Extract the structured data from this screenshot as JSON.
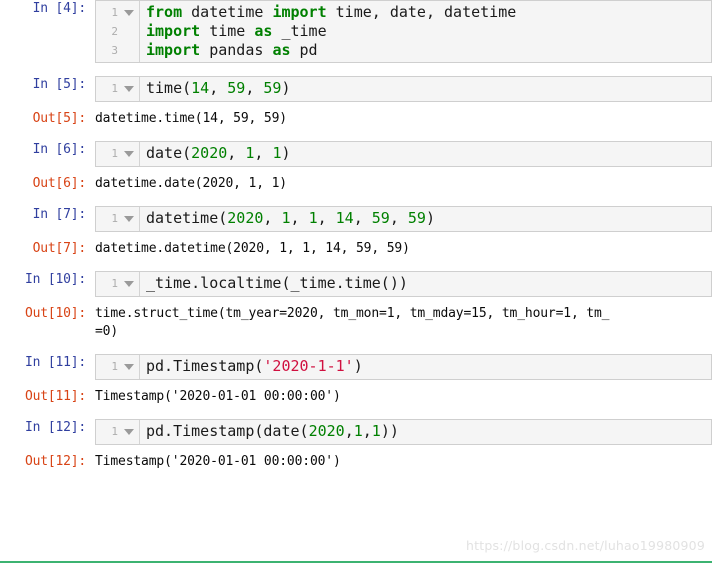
{
  "notebook": {
    "watermark": "https://blog.csdn.net/luhao19980909",
    "accent_color": "#3cb371",
    "in_prompt_color": "#303f9f",
    "out_prompt_color": "#d84315",
    "keyword_color": "#008000",
    "number_color": "#008000",
    "string_color": "#d01040",
    "cell_background": "#f5f5f5",
    "collapse_icon": "chevron-down-icon",
    "cells": [
      {
        "in_prompt": "In [4]:",
        "out_prompt": "",
        "line_numbers": [
          "1",
          "2",
          "3"
        ],
        "source_lines": [
          [
            {
              "t": "from ",
              "c": "kw"
            },
            {
              "t": "datetime ",
              "c": "pl"
            },
            {
              "t": "import ",
              "c": "kw"
            },
            {
              "t": "time, date, datetime",
              "c": "pl"
            }
          ],
          [
            {
              "t": "import ",
              "c": "kw"
            },
            {
              "t": "time ",
              "c": "pl"
            },
            {
              "t": "as ",
              "c": "kw"
            },
            {
              "t": "_time",
              "c": "pl"
            }
          ],
          [
            {
              "t": "import ",
              "c": "kw"
            },
            {
              "t": "pandas ",
              "c": "pl"
            },
            {
              "t": "as ",
              "c": "kw"
            },
            {
              "t": "pd",
              "c": "pl"
            }
          ]
        ],
        "output_lines": []
      },
      {
        "in_prompt": "In [5]:",
        "out_prompt": "Out[5]:",
        "line_numbers": [
          "1"
        ],
        "source_lines": [
          [
            {
              "t": "time(",
              "c": "pl"
            },
            {
              "t": "14",
              "c": "num"
            },
            {
              "t": ", ",
              "c": "pl"
            },
            {
              "t": "59",
              "c": "num"
            },
            {
              "t": ", ",
              "c": "pl"
            },
            {
              "t": "59",
              "c": "num"
            },
            {
              "t": ")",
              "c": "pl"
            }
          ]
        ],
        "output_lines": [
          "datetime.time(14, 59, 59)"
        ]
      },
      {
        "in_prompt": "In [6]:",
        "out_prompt": "Out[6]:",
        "line_numbers": [
          "1"
        ],
        "source_lines": [
          [
            {
              "t": "date(",
              "c": "pl"
            },
            {
              "t": "2020",
              "c": "num"
            },
            {
              "t": ", ",
              "c": "pl"
            },
            {
              "t": "1",
              "c": "num"
            },
            {
              "t": ", ",
              "c": "pl"
            },
            {
              "t": "1",
              "c": "num"
            },
            {
              "t": ")",
              "c": "pl"
            }
          ]
        ],
        "output_lines": [
          "datetime.date(2020, 1, 1)"
        ]
      },
      {
        "in_prompt": "In [7]:",
        "out_prompt": "Out[7]:",
        "line_numbers": [
          "1"
        ],
        "source_lines": [
          [
            {
              "t": "datetime(",
              "c": "pl"
            },
            {
              "t": "2020",
              "c": "num"
            },
            {
              "t": ", ",
              "c": "pl"
            },
            {
              "t": "1",
              "c": "num"
            },
            {
              "t": ", ",
              "c": "pl"
            },
            {
              "t": "1",
              "c": "num"
            },
            {
              "t": ", ",
              "c": "pl"
            },
            {
              "t": "14",
              "c": "num"
            },
            {
              "t": ", ",
              "c": "pl"
            },
            {
              "t": "59",
              "c": "num"
            },
            {
              "t": ", ",
              "c": "pl"
            },
            {
              "t": "59",
              "c": "num"
            },
            {
              "t": ")",
              "c": "pl"
            }
          ]
        ],
        "output_lines": [
          "datetime.datetime(2020, 1, 1, 14, 59, 59)"
        ]
      },
      {
        "in_prompt": "In [10]:",
        "out_prompt": "Out[10]:",
        "line_numbers": [
          "1"
        ],
        "source_lines": [
          [
            {
              "t": "_time.localtime(_time.time())",
              "c": "pl"
            }
          ]
        ],
        "output_lines": [
          "time.struct_time(tm_year=2020, tm_mon=1, tm_mday=15, tm_hour=1, tm_",
          "=0)"
        ]
      },
      {
        "in_prompt": "In [11]:",
        "out_prompt": "Out[11]:",
        "line_numbers": [
          "1"
        ],
        "source_lines": [
          [
            {
              "t": "pd.Timestamp(",
              "c": "pl"
            },
            {
              "t": "'2020-1-1'",
              "c": "str"
            },
            {
              "t": ")",
              "c": "pl"
            }
          ]
        ],
        "output_lines": [
          "Timestamp('2020-01-01 00:00:00')"
        ]
      },
      {
        "in_prompt": "In [12]:",
        "out_prompt": "Out[12]:",
        "line_numbers": [
          "1"
        ],
        "source_lines": [
          [
            {
              "t": "pd.Timestamp(date(",
              "c": "pl"
            },
            {
              "t": "2020",
              "c": "num"
            },
            {
              "t": ",",
              "c": "pl"
            },
            {
              "t": "1",
              "c": "num"
            },
            {
              "t": ",",
              "c": "pl"
            },
            {
              "t": "1",
              "c": "num"
            },
            {
              "t": "))",
              "c": "pl"
            }
          ]
        ],
        "output_lines": [
          "Timestamp('2020-01-01 00:00:00')"
        ]
      }
    ]
  }
}
